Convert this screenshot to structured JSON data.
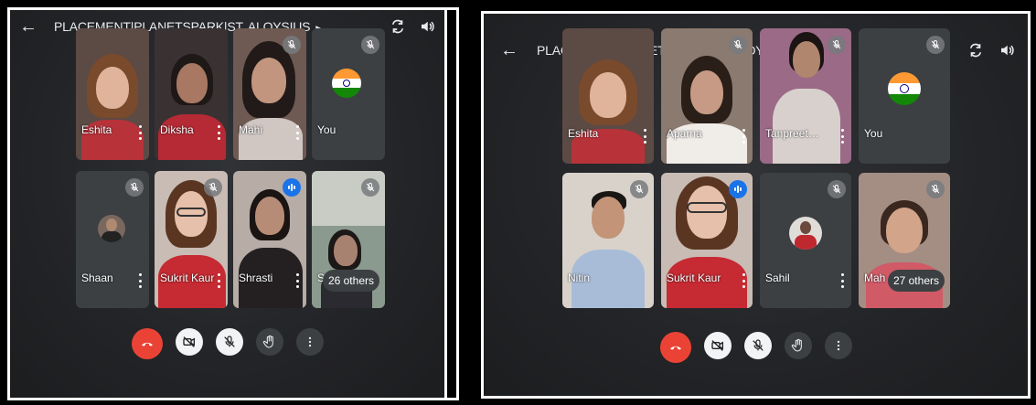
{
  "colors": {
    "end_call": "#ea4335",
    "speaking": "#1a73e8",
    "background": "#232427"
  },
  "left": {
    "title": "PLACEMENT|PLANETSPARK|ST. ALOYSIUS",
    "tiles": [
      {
        "name": "Eshita"
      },
      {
        "name": "Diksha"
      },
      {
        "name": "Mahi"
      },
      {
        "name": "You"
      },
      {
        "name": "Shaan"
      },
      {
        "name": "Sukrit Kaur"
      },
      {
        "name": "Shrasti"
      },
      {
        "name": "Sidd",
        "others": "26 others"
      }
    ]
  },
  "right": {
    "title": "PLACEMENT|PLANETSPARK|ST. ALOYSIUS",
    "tiles": [
      {
        "name": "Eshita"
      },
      {
        "name": "Aparna"
      },
      {
        "name": "Tanpreet…"
      },
      {
        "name": "You"
      },
      {
        "name": "Nitin"
      },
      {
        "name": "Sukrit Kaur"
      },
      {
        "name": "Sahil"
      },
      {
        "name": "Mah",
        "others": "27 others"
      }
    ]
  },
  "icons": {
    "back": "arrow-left-icon",
    "camera_switch": "camera-switch-icon",
    "speaker": "speaker-icon",
    "mic_off": "mic-off-icon",
    "end_call": "end-call-icon",
    "camera_off": "camera-off-icon",
    "raise_hand": "raise-hand-icon",
    "more": "more-options-icon"
  }
}
